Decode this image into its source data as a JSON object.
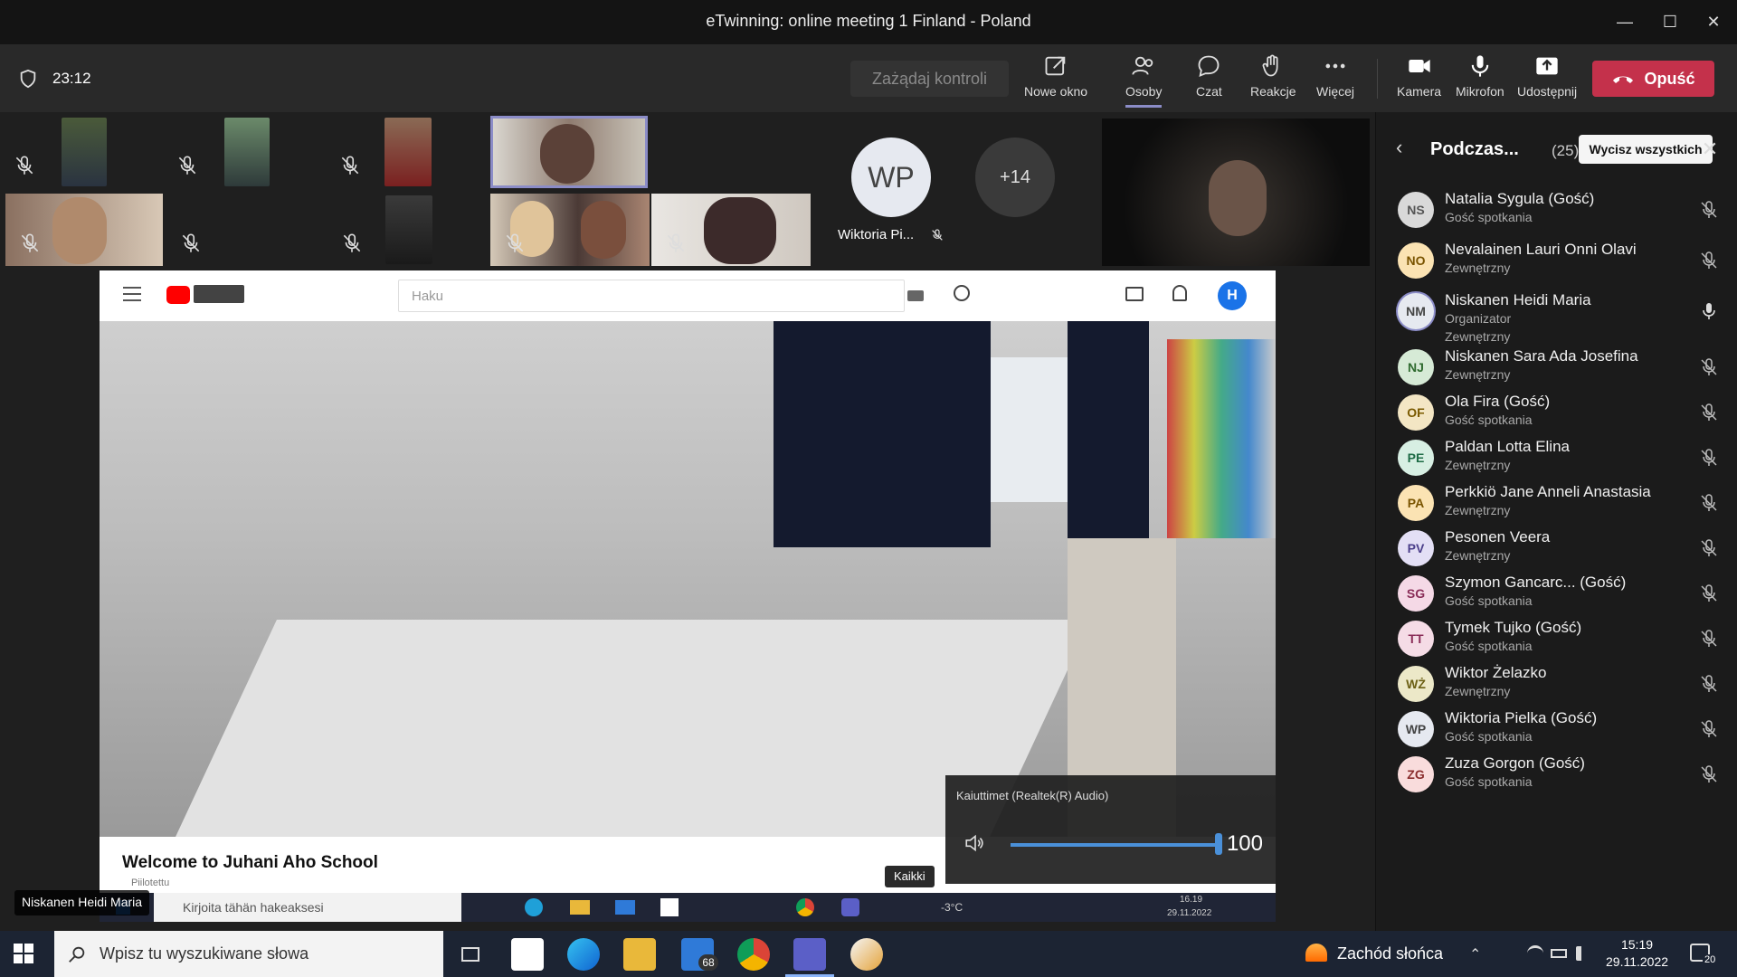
{
  "window": {
    "title": "eTwinning: online meeting 1 Finland - Poland"
  },
  "toolbar": {
    "timer": "23:12",
    "request_control": "Zażądaj kontroli",
    "buttons": [
      {
        "label": "Nowe okno",
        "icon": "popout-icon"
      },
      {
        "label": "Osoby",
        "icon": "people-icon"
      },
      {
        "label": "Czat",
        "icon": "chat-icon"
      },
      {
        "label": "Reakcje",
        "icon": "reactions-icon"
      },
      {
        "label": "Więcej",
        "icon": "more-icon"
      },
      {
        "label": "Kamera",
        "icon": "camera-icon"
      },
      {
        "label": "Mikrofon",
        "icon": "microphone-icon"
      },
      {
        "label": "Udostępnij",
        "icon": "share-icon"
      }
    ],
    "leave_label": "Opuść",
    "leave_color": "#c4314b"
  },
  "stage": {
    "avatar_initials": "WP",
    "avatar_name": "Wiktoria Pi...",
    "overflow_count": "+14",
    "presenter_label": "Niskanen Heidi Maria",
    "share": {
      "search_placeholder": "Haku",
      "video_title": "Welcome to Juhani Aho School",
      "video_subtitle": "Piilotettu",
      "volume_device": "Kaiuttimet (Realtek(R) Audio)",
      "volume_value": "100",
      "volume_level": 1.0,
      "kaikki": "Kaikki",
      "inner_search": "Kirjoita tähän hakeaksesi",
      "inner_weather": "-3°C",
      "inner_time": "16.19",
      "inner_date": "29.11.2022"
    }
  },
  "panel": {
    "title": "Podczas...",
    "count": "(25)",
    "mute_all": "Wycisz wszystkich",
    "participants": [
      {
        "initials": "NS",
        "name": "Natalia Sygula (Gość)",
        "role": "Gość spotkania",
        "color": "#d9d9d9",
        "text": "#555"
      },
      {
        "initials": "NO",
        "name": "Nevalainen Lauri Onni Olavi",
        "role": "Zewnętrzny",
        "color": "#fbe3b3",
        "text": "#7a5400"
      },
      {
        "initials": "NM",
        "name": "Niskanen Heidi Maria",
        "role": "Organizator",
        "role2": "Zewnętrzny",
        "color": "#e6e9f0",
        "text": "#444"
      },
      {
        "initials": "NJ",
        "name": "Niskanen Sara Ada Josefina",
        "role": "Zewnętrzny",
        "color": "#d6ead6",
        "text": "#2f6b2f"
      },
      {
        "initials": "OF",
        "name": "Ola Fira (Gość)",
        "role": "Gość spotkania",
        "color": "#f3e6c4",
        "text": "#7a5a00"
      },
      {
        "initials": "PE",
        "name": "Paldan Lotta Elina",
        "role": "Zewnętrzny",
        "color": "#d7efe3",
        "text": "#1d6b45"
      },
      {
        "initials": "PA",
        "name": "Perkkiö Jane Anneli Anastasia",
        "role": "Zewnętrzny",
        "color": "#fbe3b3",
        "text": "#7a5400"
      },
      {
        "initials": "PV",
        "name": "Pesonen Veera",
        "role": "Zewnętrzny",
        "color": "#e3dff5",
        "text": "#4b3f8a"
      },
      {
        "initials": "SG",
        "name": "Szymon Gancarc... (Gość)",
        "role": "Gość spotkania",
        "color": "#f5d9e6",
        "text": "#8a2d58"
      },
      {
        "initials": "TT",
        "name": "Tymek Tujko (Gość)",
        "role": "Gość spotkania",
        "color": "#f5dce6",
        "text": "#8a2d58"
      },
      {
        "initials": "WŻ",
        "name": "Wiktor Żelazko",
        "role": "Zewnętrzny",
        "color": "#ece8c8",
        "text": "#6b5f14"
      },
      {
        "initials": "WP",
        "name": "Wiktoria Pielka (Gość)",
        "role": "Gość spotkania",
        "color": "#e6e9f0",
        "text": "#444"
      },
      {
        "initials": "ZG",
        "name": "Zuza Gorgon (Gość)",
        "role": "Gość spotkania",
        "color": "#f9dcdc",
        "text": "#8a2d2d"
      }
    ]
  },
  "taskbar": {
    "search_placeholder": "Wpisz tu wyszukiwane słowa",
    "mail_badge": "68",
    "weather": "Zachód słońca",
    "time": "15:19",
    "date": "29.11.2022",
    "notifications": "20"
  }
}
